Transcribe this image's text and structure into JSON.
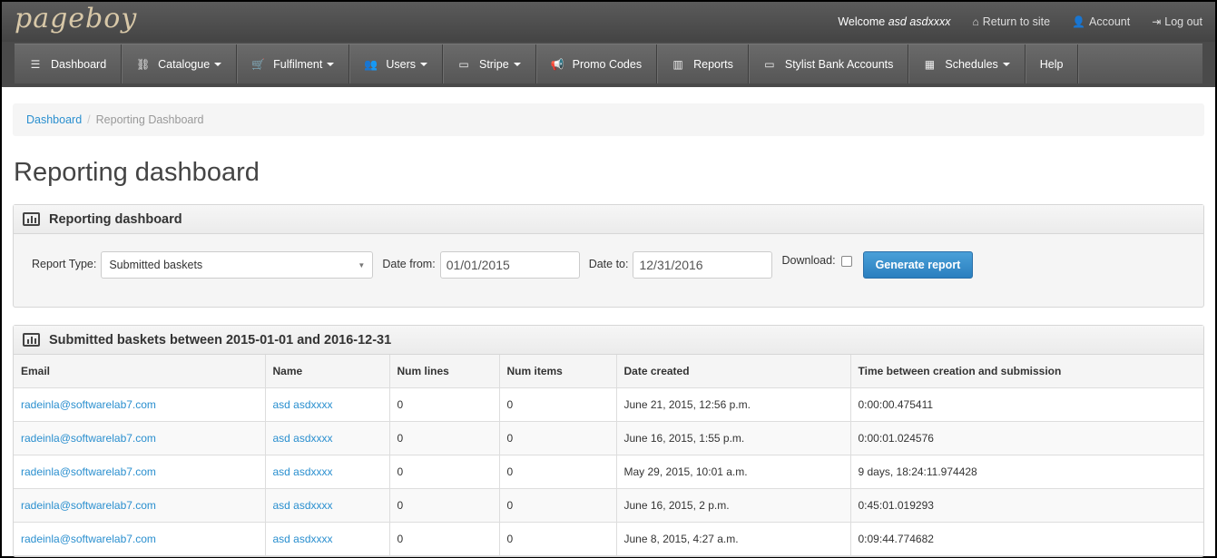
{
  "header": {
    "logo": "pageboy",
    "welcome_prefix": "Welcome",
    "user_name": "asd asdxxxx",
    "return_label": "Return to site",
    "account_label": "Account",
    "logout_label": "Log out"
  },
  "nav": [
    {
      "label": "Dashboard",
      "icon": "list-icon",
      "glyph": "☰",
      "dropdown": false
    },
    {
      "label": "Catalogue",
      "icon": "sitemap-icon",
      "glyph": "⛓",
      "dropdown": true
    },
    {
      "label": "Fulfilment",
      "icon": "cart-icon",
      "glyph": "🛒",
      "dropdown": true
    },
    {
      "label": "Users",
      "icon": "users-icon",
      "glyph": "👥",
      "dropdown": true
    },
    {
      "label": "Stripe",
      "icon": "credit-card-icon",
      "glyph": "▭",
      "dropdown": true
    },
    {
      "label": "Promo Codes",
      "icon": "bullhorn-icon",
      "glyph": "📢",
      "dropdown": false
    },
    {
      "label": "Reports",
      "icon": "bar-chart-icon",
      "glyph": "▥",
      "dropdown": false
    },
    {
      "label": "Stylist Bank Accounts",
      "icon": "credit-card-icon",
      "glyph": "▭",
      "dropdown": false
    },
    {
      "label": "Schedules",
      "icon": "calendar-icon",
      "glyph": "▦",
      "dropdown": true
    },
    {
      "label": "Help",
      "icon": "",
      "glyph": "",
      "dropdown": false
    }
  ],
  "breadcrumb": {
    "home": "Dashboard",
    "current": "Reporting Dashboard"
  },
  "page_title": "Reporting dashboard",
  "form_panel": {
    "heading": "Reporting dashboard",
    "report_type_label": "Report Type:",
    "report_type_value": "Submitted baskets",
    "date_from_label": "Date from:",
    "date_from_value": "01/01/2015",
    "date_to_label": "Date to:",
    "date_to_value": "12/31/2016",
    "download_label": "Download:",
    "generate_label": "Generate report"
  },
  "results_panel": {
    "heading": "Submitted baskets between 2015-01-01 and 2016-12-31",
    "columns": [
      "Email",
      "Name",
      "Num lines",
      "Num items",
      "Date created",
      "Time between creation and submission"
    ],
    "rows": [
      [
        "radeinla@softwarelab7.com",
        "asd asdxxxx",
        "0",
        "0",
        "June 21, 2015, 12:56 p.m.",
        "0:00:00.475411"
      ],
      [
        "radeinla@softwarelab7.com",
        "asd asdxxxx",
        "0",
        "0",
        "June 16, 2015, 1:55 p.m.",
        "0:00:01.024576"
      ],
      [
        "radeinla@softwarelab7.com",
        "asd asdxxxx",
        "0",
        "0",
        "May 29, 2015, 10:01 a.m.",
        "9 days, 18:24:11.974428"
      ],
      [
        "radeinla@softwarelab7.com",
        "asd asdxxxx",
        "0",
        "0",
        "June 16, 2015, 2 p.m.",
        "0:45:01.019293"
      ],
      [
        "radeinla@softwarelab7.com",
        "asd asdxxxx",
        "0",
        "0",
        "June 8, 2015, 4:27 a.m.",
        "0:09:44.774682"
      ]
    ]
  }
}
